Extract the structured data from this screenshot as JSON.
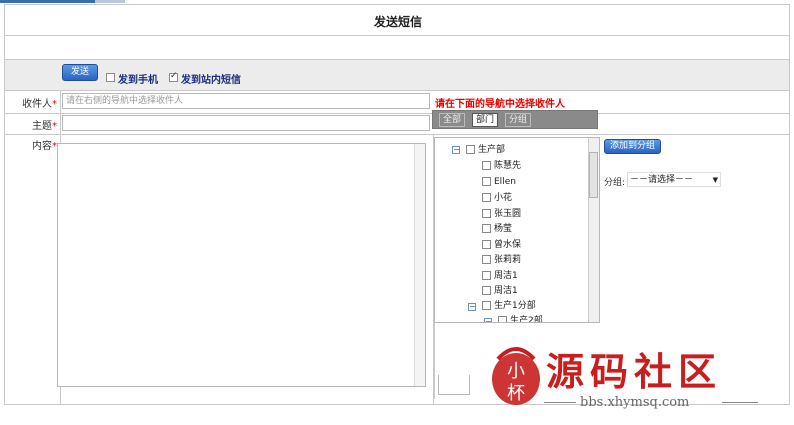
{
  "page": {
    "title": "发送短信"
  },
  "toolbar": {
    "send_label": "发送",
    "options": [
      {
        "label": "发到手机",
        "checked": false
      },
      {
        "label": "发到站内短信",
        "checked": true
      }
    ]
  },
  "form": {
    "recipient": {
      "label": "收件人",
      "required": "*",
      "placeholder": "请在右侧的导航中选择收件人"
    },
    "recipient_hint": "请在下面的导航中选择收件人",
    "subject": {
      "label": "主题",
      "required": "*",
      "value": ""
    },
    "content": {
      "label": "内容",
      "required": "*",
      "value": ""
    }
  },
  "nav_tabs": [
    {
      "label": "全部",
      "active": false
    },
    {
      "label": "部门",
      "active": true
    },
    {
      "label": "分组",
      "active": false
    }
  ],
  "tree": {
    "root": "生产部",
    "members": [
      "陈慧先",
      "Ellen",
      "小花",
      "张玉圆",
      "杨莹",
      "曾水保",
      "张莉莉",
      "周洁1",
      "周洁1"
    ],
    "sub1": "生产1分部",
    "sub2": "生产2部"
  },
  "group_panel": {
    "add_label": "添加到分组",
    "group_label": "分组:",
    "group_select": "－－请选择－－"
  },
  "watermark": {
    "logo_text": "小杯",
    "title": "源码社区",
    "url": "bbs.xhymsq.com"
  },
  "colors": {
    "accent": "#2a64c2",
    "required": "#ee0000",
    "watermark": "#c81e1e"
  }
}
